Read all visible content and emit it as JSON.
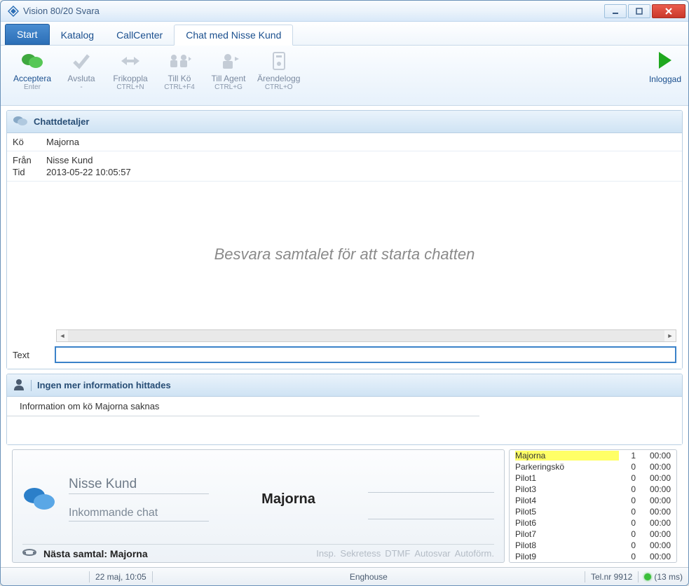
{
  "window": {
    "title": "Vision 80/20 Svara"
  },
  "tabs": {
    "start": "Start",
    "katalog": "Katalog",
    "callcenter": "CallCenter",
    "chat": "Chat med  Nisse Kund"
  },
  "ribbon": {
    "acceptera": {
      "label": "Acceptera",
      "shortcut": "Enter"
    },
    "avsluta": {
      "label": "Avsluta",
      "shortcut": "-"
    },
    "frikoppla": {
      "label": "Frikoppla",
      "shortcut": "CTRL+N"
    },
    "tillko": {
      "label": "Till Kö",
      "shortcut": "CTRL+F4"
    },
    "tillagent": {
      "label": "Till Agent",
      "shortcut": "CTRL+G"
    },
    "arendelogg": {
      "label": "Ärendelogg",
      "shortcut": "CTRL+O"
    },
    "inloggad": {
      "label": "Inloggad"
    }
  },
  "chatDetails": {
    "header": "Chattdetaljer",
    "ko_label": "Kö",
    "ko_value": "Majorna",
    "fran_label": "Från",
    "fran_value": "Nisse Kund",
    "tid_label": "Tid",
    "tid_value": "2013-05-22 10:05:57",
    "placeholderMsg": "Besvara samtalet för att starta chatten",
    "textLabel": "Text"
  },
  "infoPanel": {
    "header": "Ingen mer information hittades",
    "body": "Information om kö Majorna saknas"
  },
  "callPane": {
    "name": "Nisse Kund",
    "status": "Inkommande chat",
    "queue": "Majorna",
    "nextLabel": "Nästa samtal: Majorna",
    "flags": [
      "Insp.",
      "Sekretess",
      "DTMF",
      "Autosvar",
      "Autoförm."
    ]
  },
  "queues": [
    {
      "name": "Majorna",
      "count": 1,
      "time": "00:00",
      "highlight": true
    },
    {
      "name": "Parkeringskö",
      "count": 0,
      "time": "00:00"
    },
    {
      "name": "Pilot1",
      "count": 0,
      "time": "00:00"
    },
    {
      "name": "Pilot3",
      "count": 0,
      "time": "00:00"
    },
    {
      "name": "Pilot4",
      "count": 0,
      "time": "00:00"
    },
    {
      "name": "Pilot5",
      "count": 0,
      "time": "00:00"
    },
    {
      "name": "Pilot6",
      "count": 0,
      "time": "00:00"
    },
    {
      "name": "Pilot7",
      "count": 0,
      "time": "00:00"
    },
    {
      "name": "Pilot8",
      "count": 0,
      "time": "00:00"
    },
    {
      "name": "Pilot9",
      "count": 0,
      "time": "00:00"
    }
  ],
  "statusbar": {
    "datetime": "22 maj, 10:05",
    "company": "Enghouse",
    "telnr": "Tel.nr 9912",
    "ping": "(13 ms)"
  }
}
